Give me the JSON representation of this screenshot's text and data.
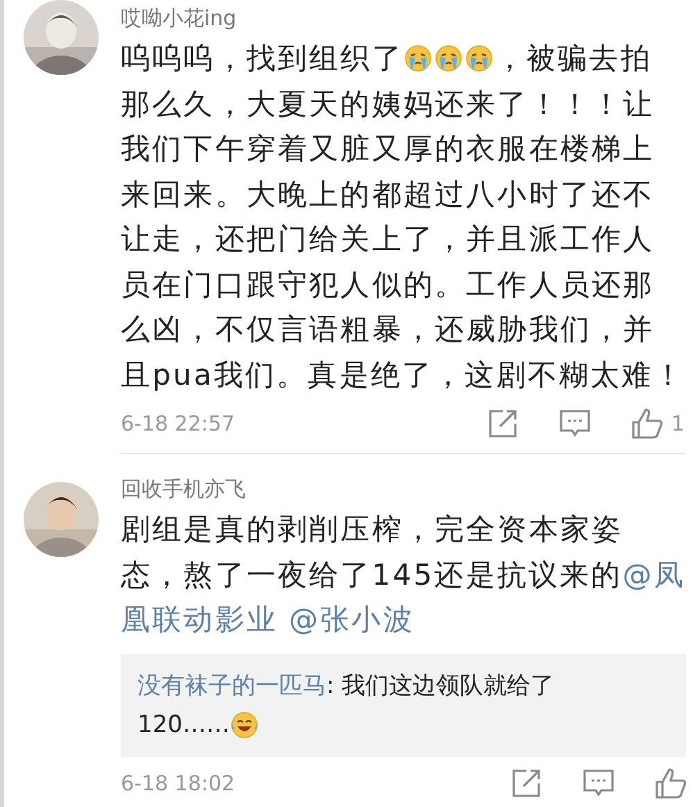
{
  "comments": [
    {
      "author": "哎呦小花ing",
      "lines": [
        [
          {
            "kind": "text",
            "text": "呜呜呜，找到组织了"
          },
          {
            "kind": "crying-emoji"
          },
          {
            "kind": "crying-emoji"
          },
          {
            "kind": "crying-emoji"
          },
          {
            "kind": "text",
            "text": "，被骗去拍"
          }
        ],
        [
          {
            "kind": "text",
            "text": "那么久，大夏天的姨妈还来了！！！让"
          }
        ],
        [
          {
            "kind": "text",
            "text": "我们下午穿着又脏又厚的衣服在楼梯上"
          }
        ],
        [
          {
            "kind": "text",
            "text": "来回来。大晚上的都超过八小时了还不"
          }
        ],
        [
          {
            "kind": "text",
            "text": "让走，还把门给关上了，并且派工作人"
          }
        ],
        [
          {
            "kind": "text",
            "text": "员在门口跟守犯人似的。工作人员还那"
          }
        ],
        [
          {
            "kind": "text",
            "text": "么凶，不仅言语粗暴，还威胁我们，并"
          }
        ],
        [
          {
            "kind": "text",
            "text": "且pua我们。真是绝了，这剧不糊太难！"
          }
        ]
      ],
      "time": "6-18 22:57",
      "likes": "1"
    },
    {
      "author": "回收手机亦飞",
      "lines": [
        [
          {
            "kind": "text",
            "text": "剧组是真的剥削压榨，完全资本家姿"
          }
        ],
        [
          {
            "kind": "text",
            "text": "态，熬了一夜给了145还是抗议来的"
          },
          {
            "kind": "mention",
            "text": "@凤"
          }
        ],
        [
          {
            "kind": "mention",
            "text": "凰联动影业"
          },
          {
            "kind": "mention",
            "text": "@张小波"
          }
        ]
      ],
      "reply": {
        "author": "没有袜子的一匹马",
        "lines": [
          [
            {
              "kind": "text",
              "text": ": 我们这边领队就给了"
            }
          ],
          [
            {
              "kind": "text",
              "text": "120……"
            },
            {
              "kind": "laughing-emoji"
            }
          ]
        ]
      },
      "time": "6-18 18:02"
    }
  ]
}
